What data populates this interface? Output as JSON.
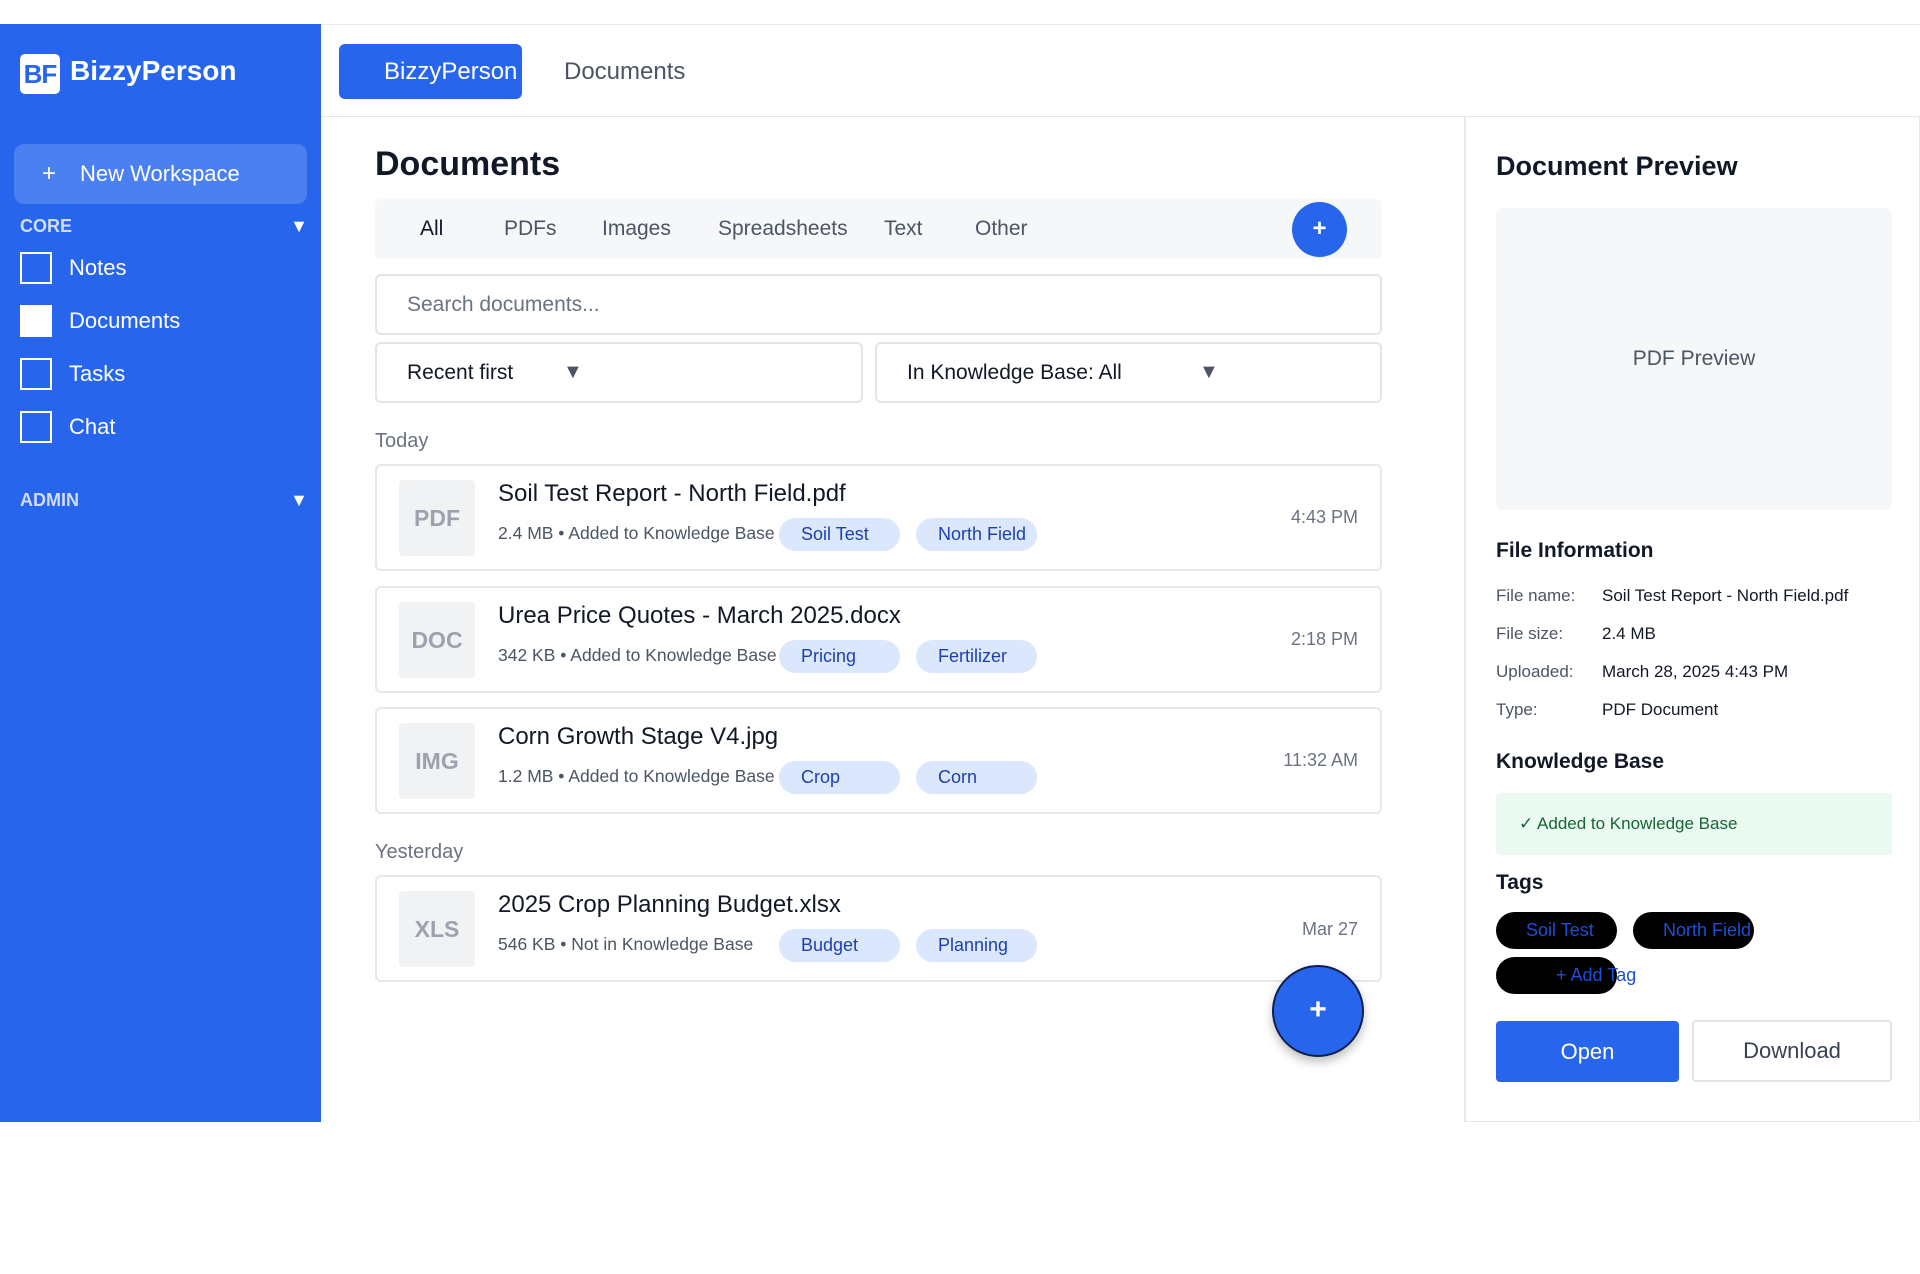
{
  "brand": {
    "logo": "BF",
    "name": "BizzyPerson"
  },
  "sidebar": {
    "new_workspace": {
      "icon": "plus-icon",
      "plus": "+",
      "label": "New Workspace"
    },
    "sections": [
      {
        "label": "CORE",
        "caret": "▼"
      },
      {
        "label": "ADMIN",
        "caret": "▼"
      }
    ],
    "items": [
      {
        "label": "Notes",
        "active": false
      },
      {
        "label": "Documents",
        "active": true
      },
      {
        "label": "Tasks",
        "active": false
      },
      {
        "label": "Chat",
        "active": false
      }
    ]
  },
  "header": {
    "tabs": [
      {
        "label": "BizzyPerson",
        "active": true
      },
      {
        "label": "Documents",
        "active": false
      }
    ]
  },
  "main": {
    "title": "Documents",
    "filter_tabs": [
      "All",
      "PDFs",
      "Images",
      "Spreadsheets",
      "Text",
      "Other"
    ],
    "add_button": "+",
    "search_placeholder": "Search documents...",
    "sort_select": {
      "value": "Recent first",
      "arrow": "▼"
    },
    "kb_select": {
      "value": "In Knowledge Base: All",
      "arrow": "▼"
    },
    "groups": [
      {
        "label": "Today",
        "docs": [
          {
            "type": "PDF",
            "name": "Soil Test Report - North Field.pdf",
            "meta": "2.4 MB • Added to Knowledge Base",
            "tags": [
              "Soil Test",
              "North Field"
            ],
            "time": "4:43 PM"
          },
          {
            "type": "DOC",
            "name": "Urea Price Quotes - March 2025.docx",
            "meta": "342 KB • Added to Knowledge Base",
            "tags": [
              "Pricing",
              "Fertilizer"
            ],
            "time": "2:18 PM"
          },
          {
            "type": "IMG",
            "name": "Corn Growth Stage V4.jpg",
            "meta": "1.2 MB • Added to Knowledge Base",
            "tags": [
              "Crop",
              "Corn"
            ],
            "time": "11:32 AM"
          }
        ]
      },
      {
        "label": "Yesterday",
        "docs": [
          {
            "type": "XLS",
            "name": "2025 Crop Planning Budget.xlsx",
            "meta": "546 KB • Not in Knowledge Base",
            "tags": [
              "Budget",
              "Planning"
            ],
            "time": "Mar 27"
          }
        ]
      }
    ],
    "fab": "+"
  },
  "preview": {
    "title": "Document Preview",
    "placeholder": "PDF Preview",
    "file_info": {
      "heading": "File Information",
      "rows": [
        {
          "key": "File name:",
          "value": "Soil Test Report - North Field.pdf"
        },
        {
          "key": "File size:",
          "value": "2.4 MB"
        },
        {
          "key": "Uploaded:",
          "value": "March 28, 2025 4:43 PM"
        },
        {
          "key": "Type:",
          "value": "PDF Document"
        }
      ]
    },
    "knowledge_base": {
      "heading": "Knowledge Base",
      "status": "✓ Added to Knowledge Base"
    },
    "tags": {
      "heading": "Tags",
      "items": [
        "Soil Test",
        "North Field"
      ],
      "add_label": "+ Add Tag"
    },
    "open_button": "Open",
    "download_button": "Download"
  },
  "colors": {
    "accent": "#2766ec",
    "tag_bg": "#dbe7fd",
    "kb_bg": "#eafaf0"
  }
}
